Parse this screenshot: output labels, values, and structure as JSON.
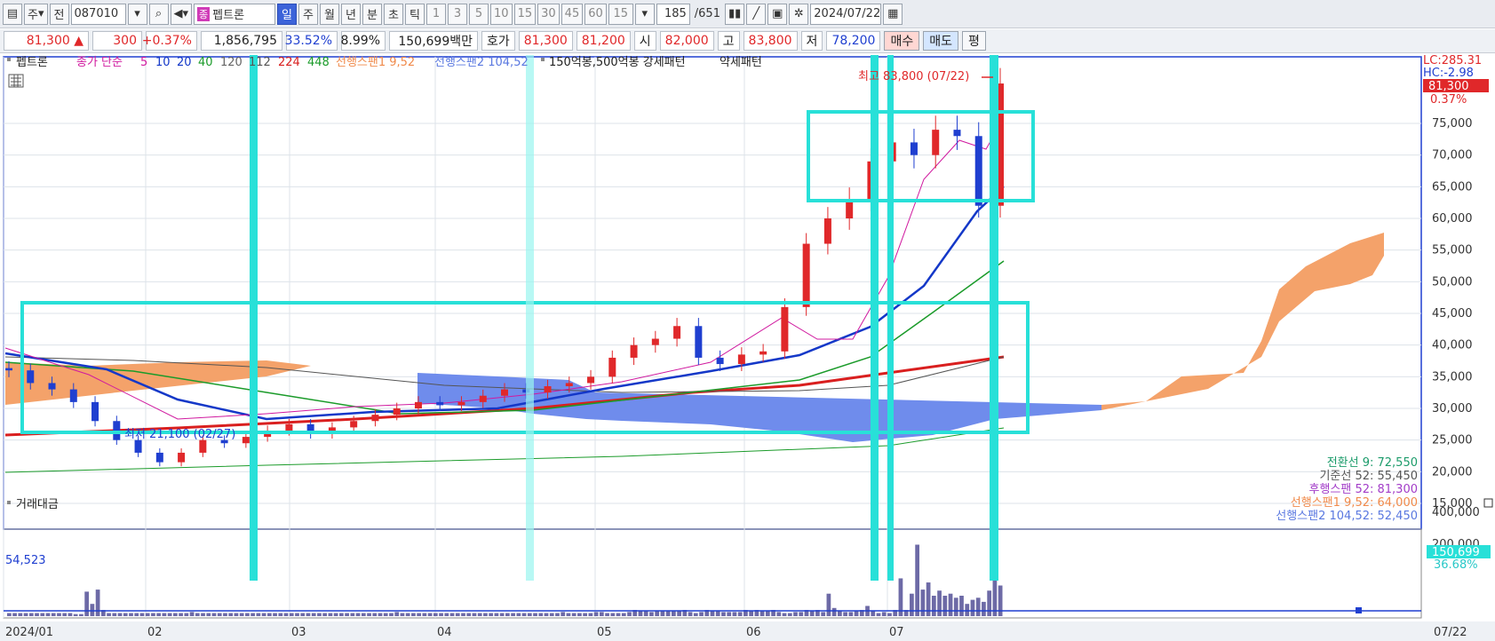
{
  "toolbar": {
    "market_type": "주",
    "prev_label": "전",
    "code": "087010",
    "stock_tag": "종",
    "stock_name": "펩트론",
    "period_tabs": [
      "일",
      "주",
      "월",
      "년",
      "분",
      "초",
      "틱"
    ],
    "selected_period": "일",
    "intervals": [
      "1",
      "3",
      "5",
      "10",
      "15",
      "30",
      "45",
      "60"
    ],
    "interval_value": "15",
    "count": "185",
    "total": "/651",
    "date": "2024/07/22"
  },
  "quote": {
    "price": "81,300",
    "arrow": "▲",
    "change": "300",
    "change_pct": "+0.37%",
    "volume": "1,856,795",
    "ratio1": "33.52%",
    "ratio2": "8.99%",
    "amount": "150,699백만",
    "hoga_label": "호가",
    "ask": "81,300",
    "bid": "81,200",
    "open_label": "시",
    "open": "82,000",
    "high_label": "고",
    "high": "83,800",
    "low_label": "저",
    "low": "78,200",
    "buy_label": "매수",
    "sell_label": "매도",
    "eq_label": "평"
  },
  "legend": {
    "name": "펩트론",
    "ma_label": "종가 단순",
    "ma_periods": [
      "5",
      "10",
      "20",
      "40",
      "120",
      "112",
      "224",
      "448"
    ],
    "ma_colors": [
      "#d0199f",
      "#1438c8",
      "#1438c8",
      "#1b9b2a",
      "#666666",
      "#555555",
      "#d91f1f",
      "#1b9b2a"
    ],
    "span1": "선행스팬1 9,52",
    "span2": "선행스팬2 104,52",
    "pattern": "150억봉,500억봉 강세패턴",
    "weak": "약세패턴"
  },
  "annotations": {
    "high": "최고 83,800 (07/22)",
    "low": "최저 21,100 (02/27)",
    "lc": "LC:285.31",
    "hc": "HC:-2.98",
    "last_price": "81,300",
    "last_pct": "0.37%",
    "vol_ref": "54,523",
    "vol_last": "150,699",
    "vol_pct": "36.68%"
  },
  "ichimoku": [
    {
      "text": "전환선 9: 72,550",
      "color": "#1b9b6a"
    },
    {
      "text": "기준선 52: 55,450",
      "color": "#555555"
    },
    {
      "text": "후행스팬 52: 81,300",
      "color": "#a23cc8"
    },
    {
      "text": "선행스팬1 9,52: 64,000",
      "color": "#f08a4b"
    },
    {
      "text": "선행스팬2 104,52: 52,450",
      "color": "#5a78e0"
    }
  ],
  "volume_label": "거래대금",
  "price_axis": [
    "75,000",
    "70,000",
    "65,000",
    "60,000",
    "55,000",
    "50,000",
    "45,000",
    "40,000",
    "35,000",
    "30,000",
    "25,000",
    "20,000",
    "15,000"
  ],
  "volume_axis": [
    "400,000",
    "200,000"
  ],
  "x_axis": [
    "2024/01",
    "02",
    "03",
    "04",
    "05",
    "06",
    "07"
  ],
  "x_axis_right": "07/22",
  "colors": {
    "up": "#e0282a",
    "down": "#1f3fd0",
    "highlight": "#28e0d8",
    "cloud_up": "#f4a26a",
    "cloud_down": "#6f8cec"
  },
  "chart_data": {
    "type": "candlestick",
    "title": "펩트론 일봉",
    "ylim": [
      15000,
      85000
    ],
    "series": [
      {
        "name": "close",
        "values": [
          36000,
          34000,
          33000,
          31000,
          28000,
          25000,
          23000,
          21500,
          23000,
          25000,
          24500,
          25500,
          26500,
          27500,
          26000,
          27000,
          28000,
          29000,
          30000,
          31000,
          30500,
          31000,
          32000,
          33000,
          32500,
          33500,
          34000,
          35000,
          38000,
          40000,
          41000,
          43000,
          38000,
          37000,
          38500,
          39000,
          46000,
          56000,
          60000,
          63000,
          69000,
          72000,
          70000,
          74000,
          73000,
          62000,
          81300
        ]
      }
    ],
    "highlights": [
      "high 83,800 on 07/22",
      "low 21,100 on 02/27"
    ]
  }
}
